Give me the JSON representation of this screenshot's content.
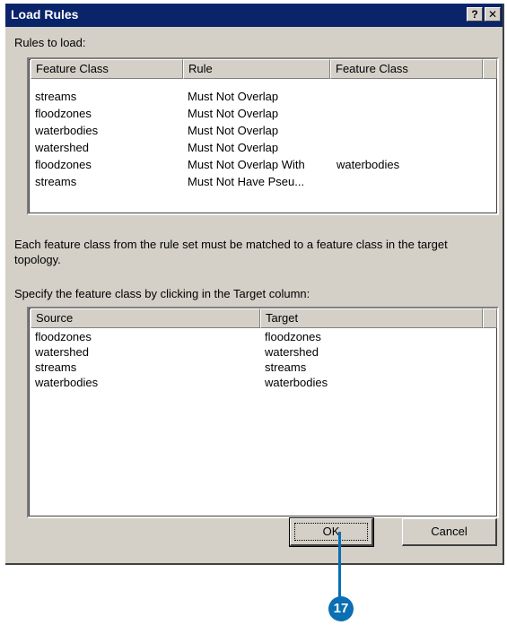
{
  "dialog": {
    "title": "Load Rules",
    "help_glyph": "?",
    "close_glyph": "✕",
    "rules_label": "Rules to load:",
    "rules_columns": [
      "Feature Class",
      "Rule",
      "Feature Class"
    ],
    "rules_rows": [
      [
        "streams",
        "Must Not Overlap",
        ""
      ],
      [
        "floodzones",
        "Must Not Overlap",
        ""
      ],
      [
        "waterbodies",
        "Must Not Overlap",
        ""
      ],
      [
        "watershed",
        "Must Not Overlap",
        ""
      ],
      [
        "floodzones",
        "Must Not Overlap With",
        "waterbodies"
      ],
      [
        "streams",
        "Must Not Have Pseu...",
        ""
      ]
    ],
    "info_text": "Each feature class from the rule set must be matched to a feature class in the target topology.",
    "specify_label": "Specify the feature class by clicking in the Target column:",
    "mapping_columns": [
      "Source",
      "Target"
    ],
    "mapping_rows": [
      [
        "floodzones",
        "floodzones"
      ],
      [
        "watershed",
        "watershed"
      ],
      [
        "streams",
        "streams"
      ],
      [
        "waterbodies",
        "waterbodies"
      ]
    ],
    "ok_label": "OK",
    "cancel_label": "Cancel"
  },
  "callout": {
    "number": "17",
    "color": "#0a6fb3"
  },
  "colors": {
    "titlebar": "#0a246a",
    "dialog_bg": "#d4d0c8"
  }
}
